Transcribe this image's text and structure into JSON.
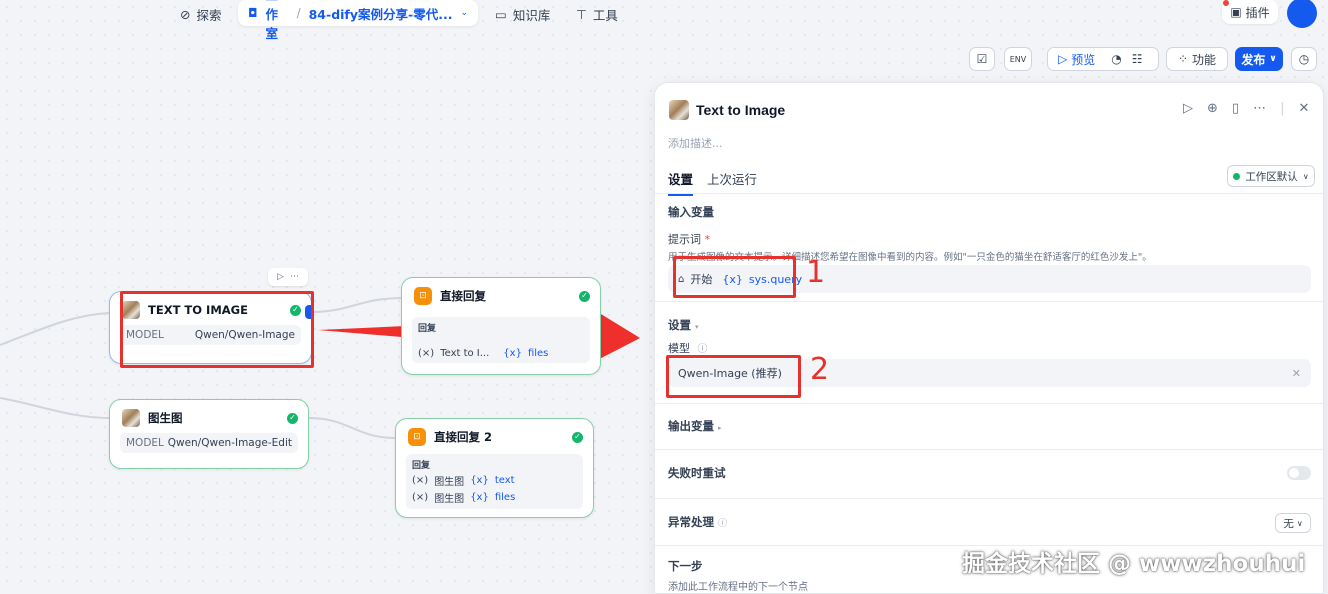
{
  "topnav": {
    "explore": "探索",
    "studio": "工作室",
    "app_name": "84-dify案例分享-零代...",
    "knowledge": "知识库",
    "tools": "工具",
    "plugins": "插件"
  },
  "toolbar": {
    "preview": "预览",
    "features": "功能",
    "publish": "发布"
  },
  "nodes": {
    "text_to_image": {
      "title": "TEXT TO IMAGE",
      "model_key": "MODEL",
      "model_value": "Qwen/Qwen-Image"
    },
    "image_to_image": {
      "title": "图生图",
      "model_key": "MODEL",
      "model_value": "Qwen/Qwen-Image-Edit"
    },
    "reply1": {
      "title": "直接回复",
      "label": "回复",
      "var_source": "Text to I...",
      "var_name": "files"
    },
    "reply2": {
      "title": "直接回复 2",
      "label": "回复",
      "var1_source": "图生图",
      "var1_name": "text",
      "var2_source": "图生图",
      "var2_name": "files"
    }
  },
  "panel": {
    "title": "Text to Image",
    "description_placeholder": "添加描述...",
    "tab_settings": "设置",
    "tab_last_run": "上次运行",
    "workspace_default": "工作区默认",
    "input_vars_title": "输入变量",
    "prompt_label": "提示词",
    "required_mark": "*",
    "prompt_hint": "用于生成图像的文本提示。详细描述您希望在图像中看到的内容。例如\"一只金色的猫坐在舒适客厅的红色沙发上\"。",
    "prompt_source": "开始",
    "prompt_var": "sys.query",
    "settings_title": "设置",
    "model_label": "模型",
    "model_value": "Qwen-Image (推荐)",
    "output_vars_title": "输出变量",
    "retry_title": "失败时重试",
    "error_title": "异常处理",
    "error_value": "无",
    "next_step_title": "下一步",
    "next_step_hint": "添加此工作流程中的下一个节点"
  },
  "annotations": {
    "num1": "1",
    "num2": "2",
    "color": "#e5322d"
  },
  "watermark": "掘金技术社区 @ wwwzhouhui",
  "colors": {
    "accent": "#155aef",
    "success": "#12b76a",
    "warning": "#f79009"
  }
}
